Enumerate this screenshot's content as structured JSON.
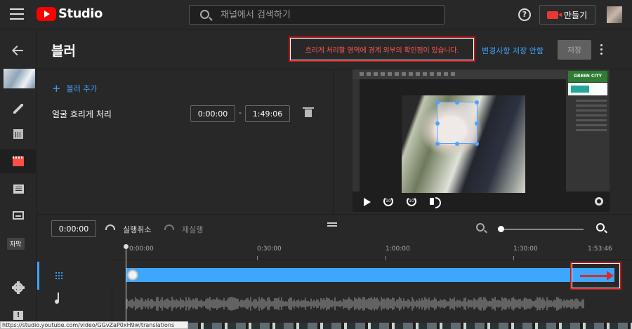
{
  "app": {
    "logo_text": "Studio",
    "search_placeholder": "채널에서 검색하기",
    "create_label": "만들기"
  },
  "sidebar": {
    "caption_badge": "자막"
  },
  "header": {
    "title": "블러",
    "notice": "흐리게 처리할 영역에 경계 외부의 확인점이 있습니다.",
    "discard_label": "변경사항 저장 안함",
    "save_label": "저장"
  },
  "editor": {
    "add_blur_label": "블러 추가",
    "face_blur_label": "얼굴 흐리게 처리",
    "start_time": "0:00:00",
    "end_time": "1:49:06",
    "dash": "-"
  },
  "timeline": {
    "current_time": "0:00:00",
    "undo_label": "실행취소",
    "redo_label": "재실행",
    "ruler": [
      "0:00:00",
      "0:30:00",
      "1:00:00",
      "1:30:00",
      "1:53:46"
    ],
    "zoom_level": 0
  },
  "status_bar": {
    "url": "https://studio.youtube.com/video/GGvZaP0xH9w/translations"
  },
  "colors": {
    "accent": "#3ea6ff",
    "error": "#ff5252",
    "highlight_border": "#b71c1c",
    "brand": "#ff0000"
  }
}
